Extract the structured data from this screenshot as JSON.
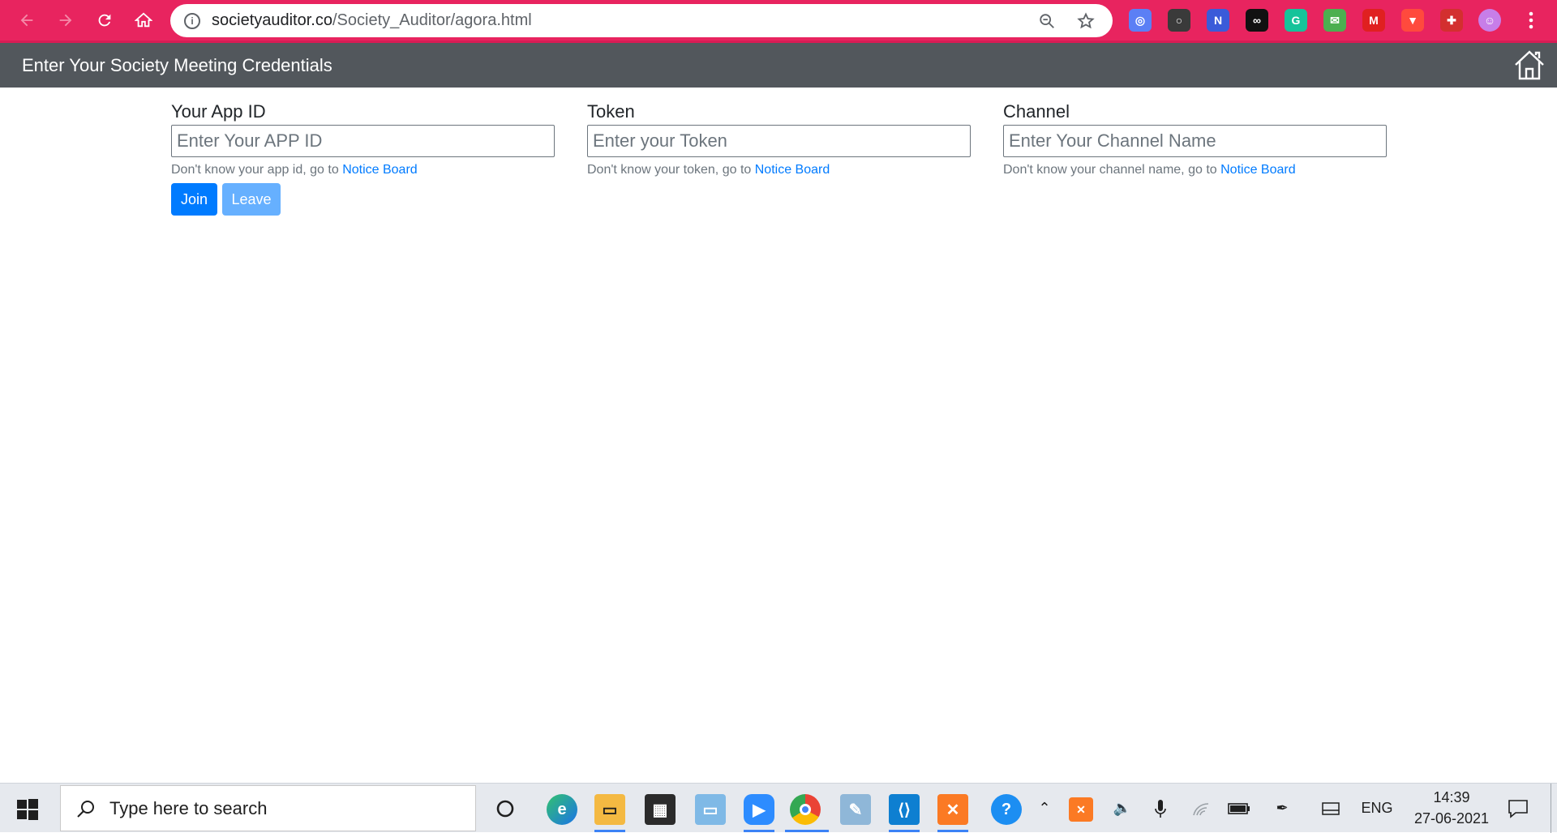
{
  "browser": {
    "url_domain": "societyauditor.co",
    "url_path": "/Society_Auditor/agora.html",
    "accent": "#e8245f",
    "extensions": [
      {
        "name": "camera-extension-icon",
        "color": "#5b7ff5",
        "glyph": "◎"
      },
      {
        "name": "circle-extension-icon",
        "color": "#3a3a3a",
        "glyph": "○"
      },
      {
        "name": "n-extension-icon",
        "color": "#3a5bd9",
        "glyph": "N"
      },
      {
        "name": "infinity-extension-icon",
        "color": "#111111",
        "glyph": "∞"
      },
      {
        "name": "grammarly-extension-icon",
        "color": "#15c39a",
        "glyph": "G"
      },
      {
        "name": "mail-extension-icon",
        "color": "#4caf50",
        "glyph": "✉"
      },
      {
        "name": "m-extension-icon",
        "color": "#e02020",
        "glyph": "M"
      },
      {
        "name": "shield-extension-icon",
        "color": "#ff4a3d",
        "glyph": "▼"
      },
      {
        "name": "puzzle-extension-icon",
        "color": "#d32f2f",
        "glyph": "✚"
      }
    ]
  },
  "header": {
    "title": "Enter Your Society Meeting Credentials"
  },
  "form": {
    "app_id": {
      "label": "Your App ID",
      "placeholder": "Enter Your APP ID",
      "help_text": "Don't know your app id, go to ",
      "help_link": "Notice Board"
    },
    "token": {
      "label": "Token",
      "placeholder": "Enter your Token",
      "help_text": "Don't know your token, go to ",
      "help_link": "Notice Board"
    },
    "channel": {
      "label": "Channel",
      "placeholder": "Enter Your Channel Name",
      "help_text": "Don't know your channel name, go to ",
      "help_link": "Notice Board"
    },
    "join_label": "Join",
    "leave_label": "Leave"
  },
  "taskbar": {
    "search_placeholder": "Type here to search",
    "language": "ENG",
    "time": "14:39",
    "date": "27-06-2021"
  }
}
